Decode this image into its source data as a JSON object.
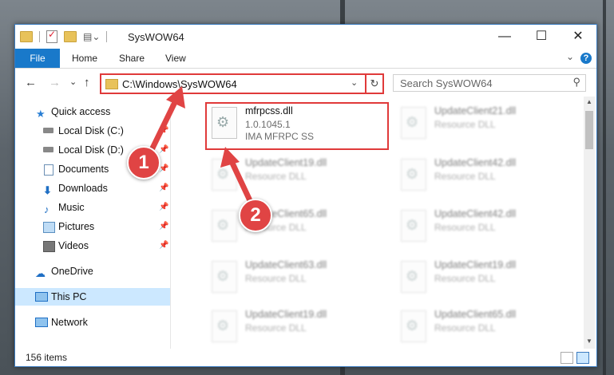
{
  "window": {
    "title": "SysWOW64"
  },
  "window_controls": {
    "minimize": "—",
    "maximize": "☐",
    "close": "✕"
  },
  "ribbon": {
    "tabs": [
      "File",
      "Home",
      "Share",
      "View"
    ],
    "collapse": "⌄",
    "help": "?"
  },
  "nav": {
    "back": "←",
    "forward": "→",
    "recent": "⌄",
    "up": "↑",
    "address": "C:\\Windows\\SysWOW64",
    "address_dropdown": "⌄",
    "refresh": "↻",
    "search_placeholder": "Search SysWOW64",
    "search_icon": "⚲"
  },
  "sidebar": {
    "items": [
      {
        "label": "Quick access",
        "icon": "star-icon"
      },
      {
        "label": "Local Disk (C:)",
        "icon": "drive-icon",
        "pinned": true
      },
      {
        "label": "Local Disk (D:)",
        "icon": "drive-icon",
        "pinned": true
      },
      {
        "label": "Documents",
        "icon": "documents-icon",
        "pinned": true
      },
      {
        "label": "Downloads",
        "icon": "download-icon",
        "pinned": true
      },
      {
        "label": "Music",
        "icon": "music-icon",
        "pinned": true
      },
      {
        "label": "Pictures",
        "icon": "pictures-icon",
        "pinned": true
      },
      {
        "label": "Videos",
        "icon": "videos-icon",
        "pinned": true
      },
      {
        "label": "OneDrive",
        "icon": "cloud-icon"
      },
      {
        "label": "This PC",
        "icon": "computer-icon",
        "selected": true
      },
      {
        "label": "Network",
        "icon": "network-icon"
      }
    ],
    "pin_glyph": "📌"
  },
  "files": [
    {
      "name": "mfrpcss.dll",
      "line2": "1.0.1045.1",
      "line3": "IMA MFRPC SS",
      "highlighted": true
    },
    {
      "name": "UpdateClient21.dll",
      "line2": "Resource DLL"
    },
    {
      "name": "UpdateClient19.dll",
      "line2": "Resource DLL"
    },
    {
      "name": "UpdateClient42.dll",
      "line2": "Resource DLL"
    },
    {
      "name": "UpdateClient65.dll",
      "line2": "Resource DLL"
    },
    {
      "name": "UpdateClient42.dll",
      "line2": "Resource DLL"
    },
    {
      "name": "UpdateClient63.dll",
      "line2": "Resource DLL"
    },
    {
      "name": "UpdateClient19.dll",
      "line2": "Resource DLL"
    },
    {
      "name": "UpdateClient19.dll",
      "line2": "Resource DLL"
    },
    {
      "name": "UpdateClient65.dll",
      "line2": "Resource DLL"
    }
  ],
  "status": {
    "item_count": "156 items"
  },
  "callouts": [
    "1",
    "2"
  ],
  "colors": {
    "accent": "#1979ca",
    "highlight": "#e03a3a",
    "selected_bg": "#cce8ff"
  }
}
